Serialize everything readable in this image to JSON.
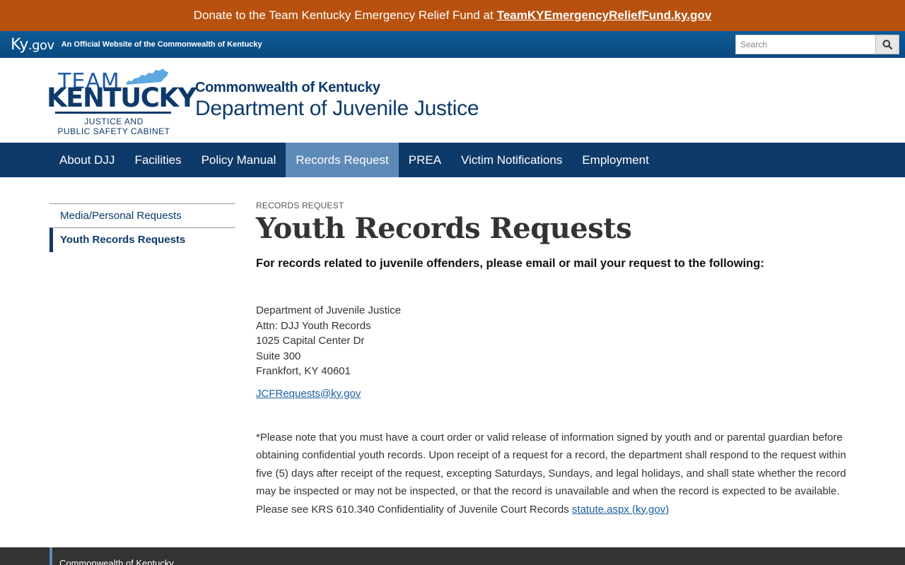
{
  "donate": {
    "text": "Donate to the Team Kentucky Emergency Relief Fund at",
    "link": "TeamKYEmergencyReliefFund.ky.gov"
  },
  "kygov": {
    "logo": "Ky",
    "logo_suffix": ".gov",
    "official": "An Official Website of the Commonwealth of Kentucky",
    "search_placeholder": "Search"
  },
  "brand": {
    "team": "TEAM",
    "kentucky": "KENTUCKY",
    "sub1": "JUSTICE AND",
    "sub2": "PUBLIC SAFETY CABINET",
    "top": "Commonwealth of Kentucky",
    "main": "Department of Juvenile Justice"
  },
  "nav": {
    "items": [
      {
        "label": "About DJJ"
      },
      {
        "label": "Facilities"
      },
      {
        "label": "Policy Manual"
      },
      {
        "label": "Records Request",
        "active": true
      },
      {
        "label": "PREA"
      },
      {
        "label": "Victim Notifications"
      },
      {
        "label": "Employment"
      }
    ]
  },
  "sidebar": {
    "items": [
      {
        "label": "Media/Personal Requests"
      },
      {
        "label": "Youth Records Requests",
        "active": true
      }
    ]
  },
  "main": {
    "eyebrow": "RECORDS REQUEST",
    "title": "Youth Records Requests",
    "intro": "For records related to juvenile offenders, please email or mail your request to the following:",
    "address": [
      "Department of Juvenile Justice",
      "Attn: DJJ Youth Records",
      "1025 Capital Center Dr",
      "Suite 300",
      "Frankfort, KY 40601"
    ],
    "email": "JCFRequests@ky.gov",
    "note": "*Please note that you must have a court order or valid release of information signed by youth and or parental guardian before obtaining confidential youth records. Upon receipt of a request for a record, the department shall respond to the request within five (5) days after receipt of the request, excepting Saturdays, Sundays, and legal holidays, and shall state whether the record may be inspected or may not be inspected, or that the record is unavailable and when the record is expected to be available. Please see KRS 610.340 Confidentiality of Juvenile Court Records",
    "note_link": "statute.aspx (ky.gov)"
  },
  "footer": {
    "title": "Commonwealth of Kentucky"
  },
  "colors": {
    "donate_bar": "#b8510f",
    "nav_bg": "#0e3a6a",
    "nav_active": "#5e8ab8",
    "link": "#1a5ea0"
  }
}
